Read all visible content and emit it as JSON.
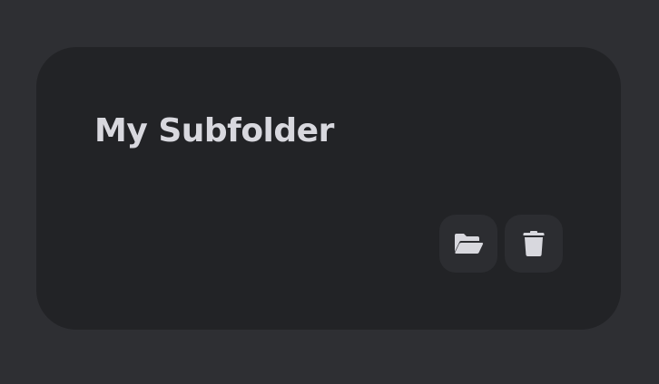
{
  "folder_card": {
    "title": "My Subfolder",
    "actions": [
      {
        "name": "open-folder-button",
        "icon": "folder-open-icon"
      },
      {
        "name": "delete-button",
        "icon": "trash-icon"
      }
    ]
  },
  "colors": {
    "page_background": "#2e2f33",
    "card_background": "#222326",
    "button_background": "#2c2d31",
    "text": "#d8d8de",
    "icon": "#d8d8de"
  }
}
